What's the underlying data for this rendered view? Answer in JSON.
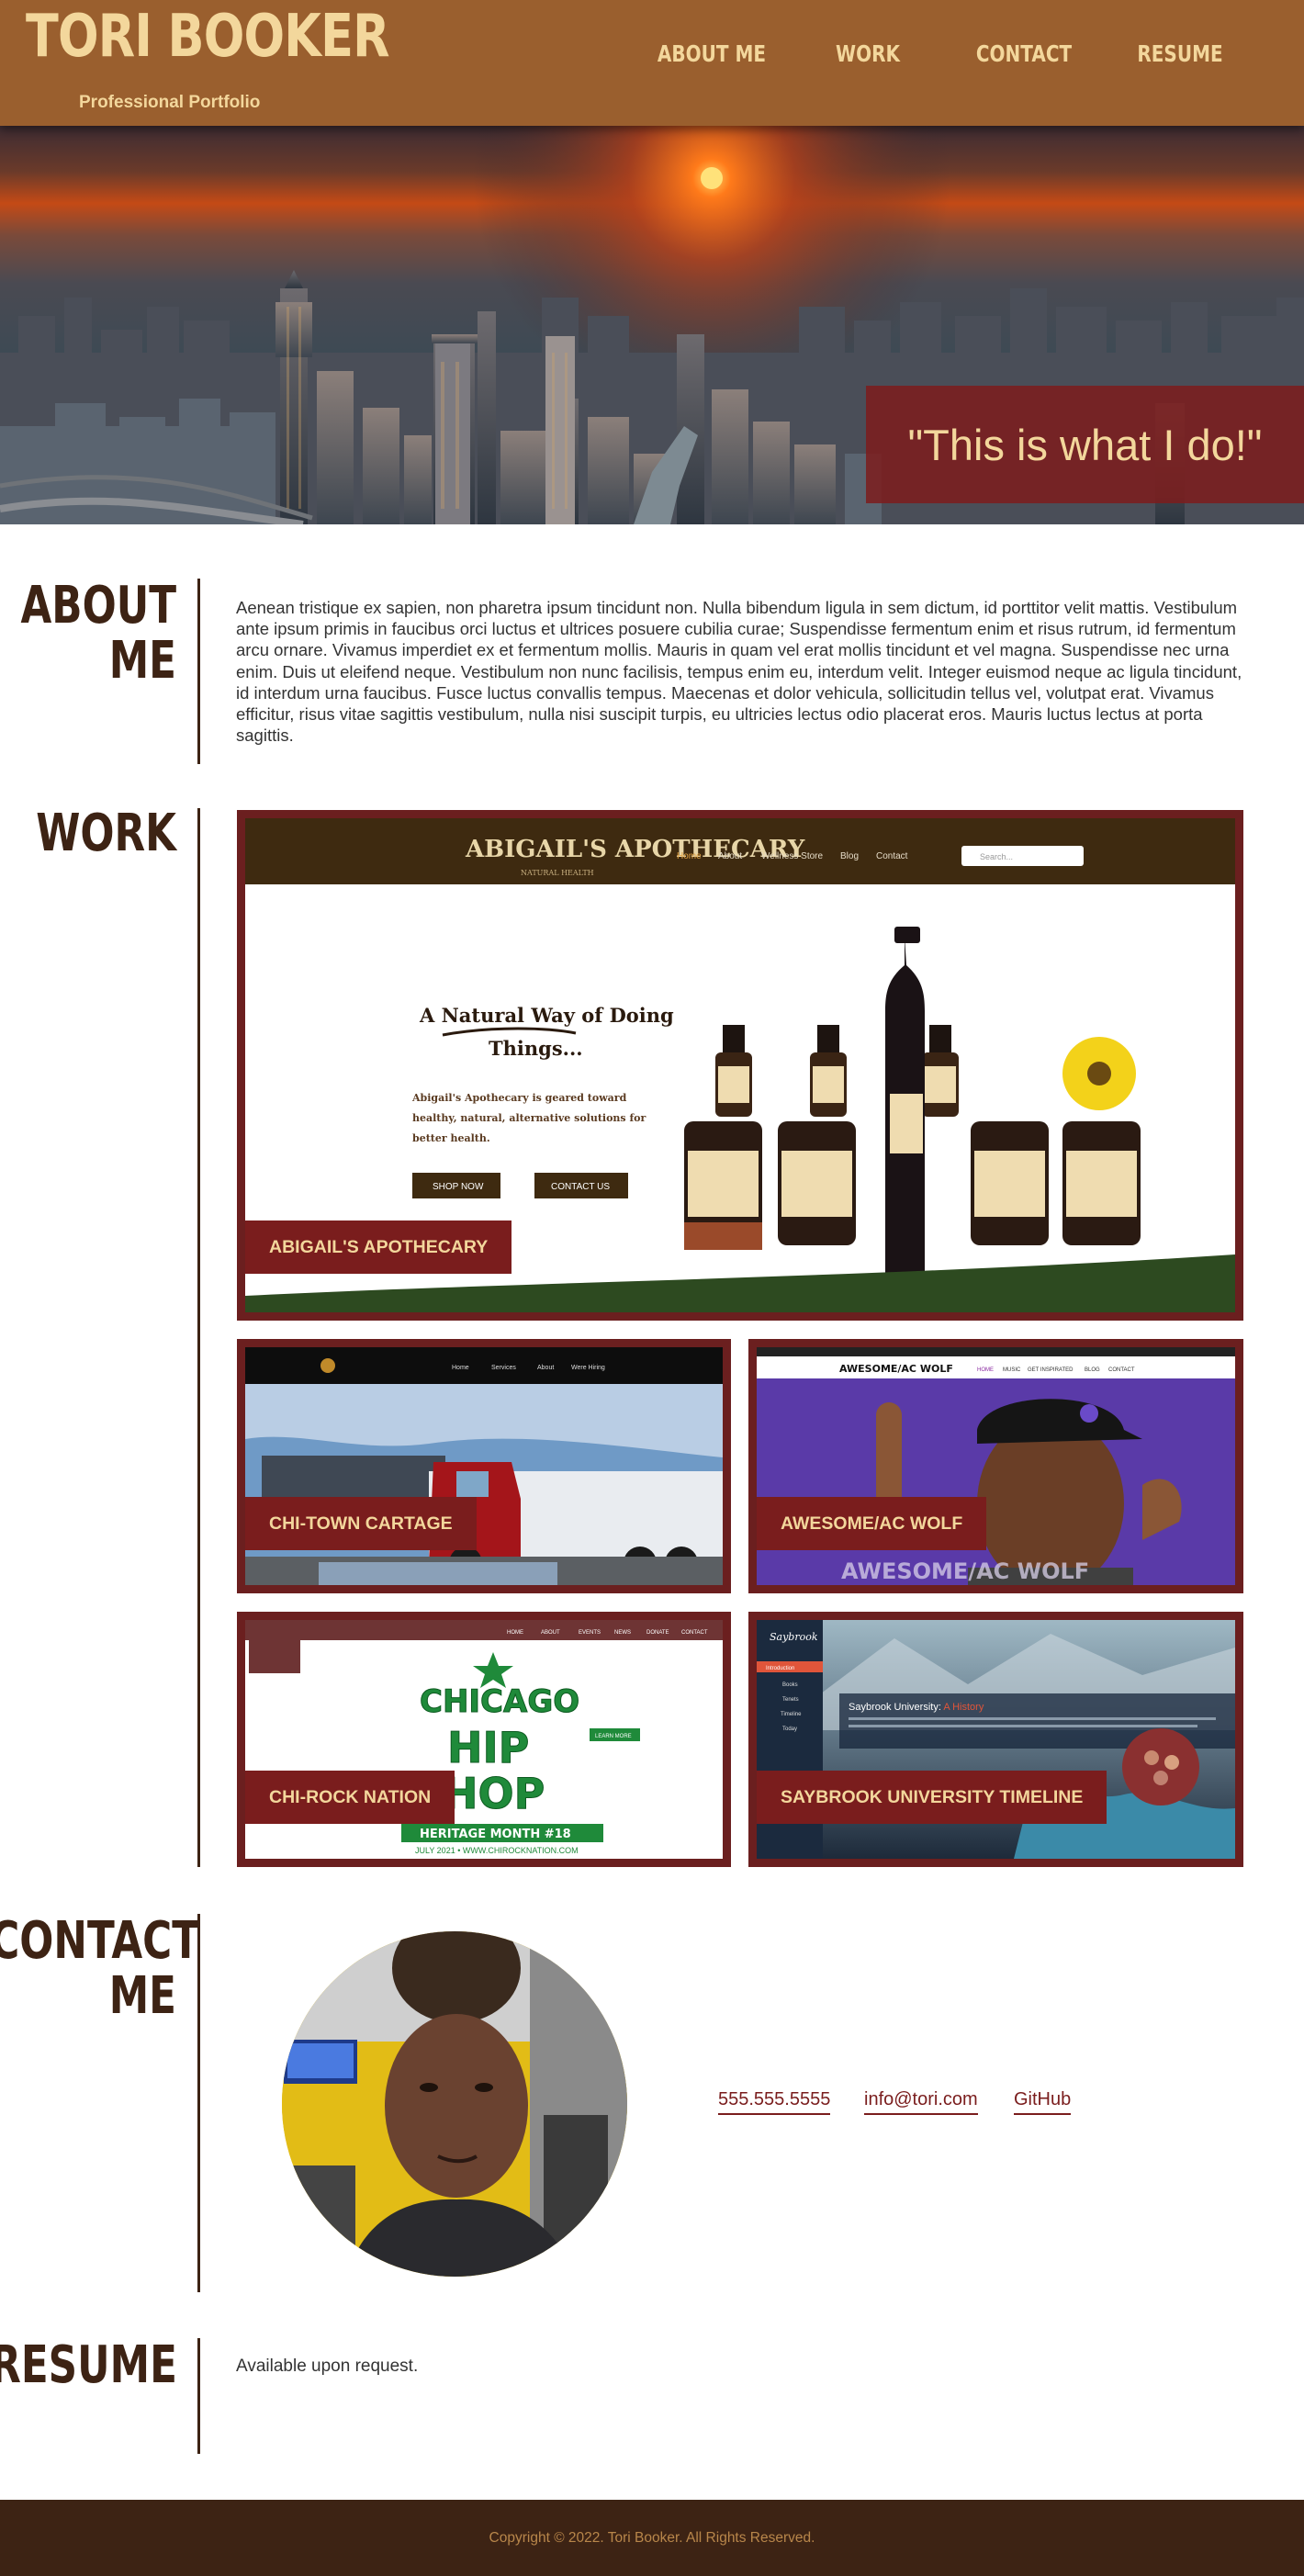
{
  "header": {
    "brand": "TORI BOOKER",
    "tagline": "Professional Portfolio",
    "nav": [
      "ABOUT ME",
      "WORK",
      "CONTACT",
      "RESUME"
    ]
  },
  "hero": {
    "quote": "\"This is what I do!\""
  },
  "about": {
    "title_line1": "ABOUT",
    "title_line2": "ME",
    "text": "Aenean tristique ex sapien, non pharetra ipsum tincidunt non. Nulla bibendum ligula in sem dictum, id porttitor velit mattis. Vestibulum ante ipsum primis in faucibus orci luctus et ultrices posuere cubilia curae; Suspendisse fermentum enim et risus rutrum, id fermentum arcu ornare. Vivamus imperdiet ex et fermentum mollis. Mauris in quam vel erat mollis tincidunt et vel magna. Suspendisse nec urna enim. Duis ut eleifend neque. Vestibulum non nunc facilisis, tempus enim eu, interdum velit. Integer euismod neque ac ligula tincidunt, id interdum urna faucibus. Fusce luctus convallis tempus. Maecenas et dolor vehicula, sollicitudin tellus vel, volutpat erat. Vivamus efficitur, risus vitae sagittis vestibulum, nulla nisi suscipit turpis, eu ultricies lectus odio placerat eros. Mauris luctus lectus at porta sagittis."
  },
  "work": {
    "title": "WORK",
    "projects": [
      {
        "label": "ABIGAIL'S APOTHECARY",
        "shot": {
          "logo": "ABIGAIL'S APOTHECARY",
          "logo_sub": "NATURAL HEALTH",
          "nav": [
            "Home",
            "About",
            "Wellness Store",
            "Blog",
            "Contact"
          ],
          "search": "Search...",
          "headline_1": "A Natural Way of Doing",
          "headline_2": "Things...",
          "body": [
            "Abigail's Apothecary is geared toward",
            "healthy, natural, alternative solutions for",
            "better health."
          ],
          "btn_shop": "SHOP NOW",
          "btn_contact": "CONTACT US"
        }
      },
      {
        "label": "CHI-TOWN CARTAGE",
        "shot": {
          "nav": [
            "Home",
            "Services",
            "About",
            "Were Hiring"
          ]
        }
      },
      {
        "label": "AWESOME/AC WOLF",
        "shot": {
          "logo": "AWESOME/AC WOLF",
          "nav": [
            "HOME",
            "MUSIC",
            "GET INSPIRATED",
            "BLOG",
            "CONTACT"
          ],
          "overlay": "AWESOME/AC WOLF"
        }
      },
      {
        "label": "CHI-ROCK NATION",
        "shot": {
          "nav": [
            "HOME",
            "ABOUT",
            "EVENTS",
            "NEWS",
            "DONATE",
            "CONTACT"
          ],
          "art_1": "CHICAGO",
          "art_2": "HIP",
          "art_3": "HOP",
          "ribbon": "HERITAGE MONTH #18",
          "ribbon_sub": "JULY 2021 • WWW.CHIROCKNATION.COM",
          "btn": "LEARN MORE"
        }
      },
      {
        "label": "SAYBROOK UNIVERSITY TIMELINE",
        "shot": {
          "logo": "Saybrook",
          "side": [
            "Introduction",
            "Books",
            "Tenets",
            "Timeline",
            "Today"
          ],
          "title_a": "Saybrook University: ",
          "title_b": "A History"
        }
      }
    ]
  },
  "contact": {
    "title_line1": "CONTACT",
    "title_line2": "ME",
    "phone": "555.555.5555",
    "email": "info@tori.com",
    "github": "GitHub"
  },
  "resume": {
    "title": "RESUME",
    "text": "Available upon request."
  },
  "footer": {
    "copyright": "Copyright © 2022. Tori Booker. All Rights Reserved."
  },
  "colors": {
    "header": "#9a5f2e",
    "accent": "#7a1d1d",
    "cream": "#f3d79c",
    "dark_brown": "#3d2314"
  }
}
